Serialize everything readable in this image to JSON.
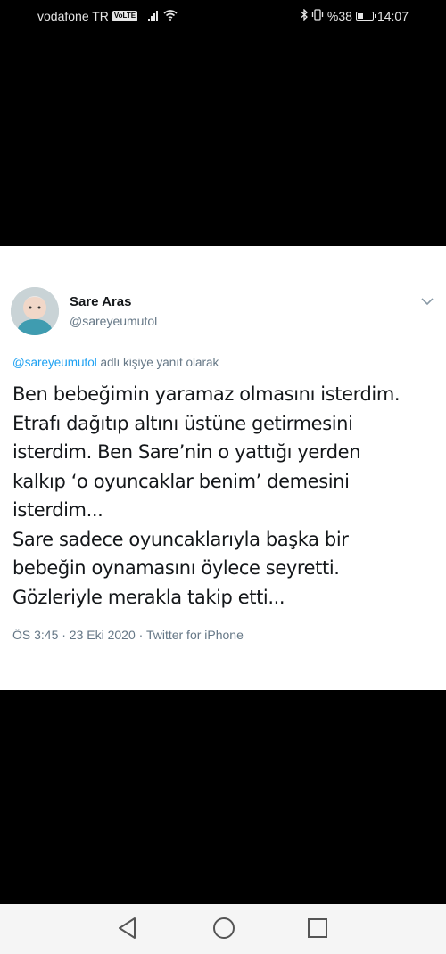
{
  "status_bar": {
    "carrier": "vodafone TR",
    "volte": "VoLTE",
    "battery_text": "%38",
    "battery_level": 0.38,
    "time": "14:07"
  },
  "tweet": {
    "author_name": "Sare Aras",
    "author_handle": "@sareyeumutol",
    "reply_mention": "@sareyeumutol",
    "reply_suffix": " adlı kişiye yanıt olarak",
    "body_lines": [
      "Ben bebeğimin yaramaz olmasını isterdim.",
      "Etrafı dağıtıp altını üstüne getirmesini",
      "isterdim. Ben Sare’nin o yattığı yerden",
      "kalkıp ‘o oyuncaklar benim’ demesini",
      "isterdim...",
      "Sare sadece oyuncaklarıyla başka bir",
      "bebeğin oynamasını öylece seyretti.",
      "Gözleriyle merakla takip etti..."
    ],
    "meta": "ÖS 3:45 · 23 Eki 2020 · Twitter for iPhone"
  },
  "icons": {
    "more": "chevron-down-icon",
    "back": "back-triangle-icon",
    "home": "home-circle-icon",
    "recents": "recents-square-icon"
  }
}
